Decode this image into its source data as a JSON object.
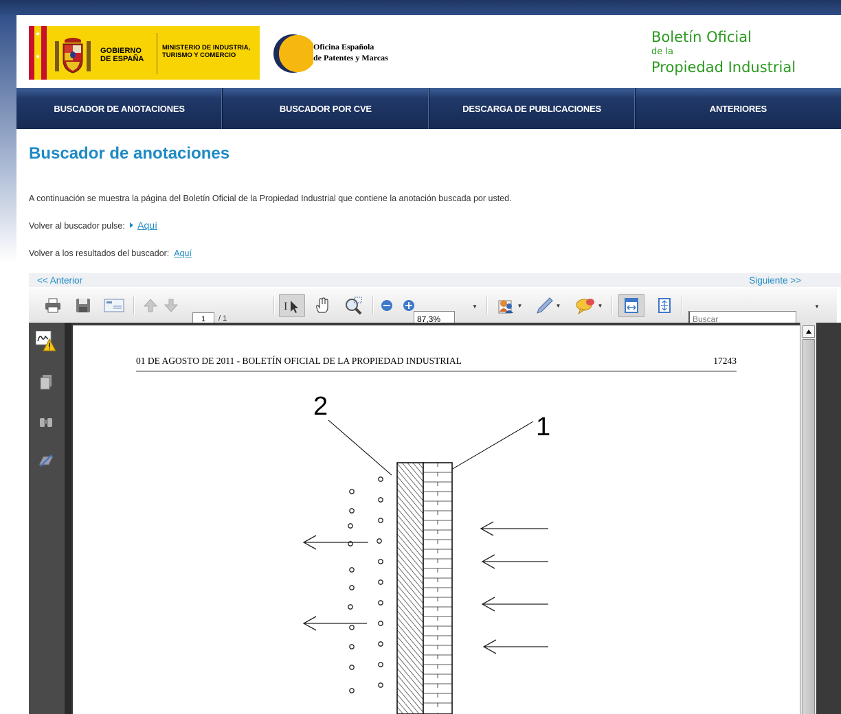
{
  "header": {
    "gov_name": "GOBIERNO DE ESPAÑA",
    "ministry": "MINISTERIO DE INDUSTRIA, TURISMO Y COMERCIO",
    "oepm_line1": "Oficina Española",
    "oepm_line2": "de Patentes y Marcas",
    "bopi_line1": "Boletín Oficial",
    "bopi_line2": "de la",
    "bopi_line3": "Propiedad Industrial",
    "colors": {
      "gov_yellow": "#f9d405",
      "bopi_green": "#2c9a1f",
      "oepm_orange": "#f6b70f",
      "oepm_navy": "#1d2b5c"
    }
  },
  "nav": {
    "items": [
      {
        "label": "BUSCADOR DE ANOTACIONES"
      },
      {
        "label": "BUSCADOR POR CVE"
      },
      {
        "label": "DESCARGA DE PUBLICACIONES"
      },
      {
        "label": "ANTERIORES"
      }
    ]
  },
  "main": {
    "title": "Buscador de anotaciones",
    "intro": "A continuación se muestra la página del Boletín Oficial de la Propiedad Industrial que contiene la anotación buscada por usted.",
    "back_search_label": "Volver al buscador pulse:",
    "back_search_link": "Aquí",
    "back_results_label": "Volver a los resultados del buscador:",
    "back_results_link": "Aquí"
  },
  "pager": {
    "prev": "<< Anterior",
    "next": "Siguiente >>"
  },
  "toolbar": {
    "page_current": "1",
    "page_total": "/ 1",
    "zoom": "87,3%",
    "search_placeholder": "Buscar",
    "icons": [
      "print-icon",
      "save-icon",
      "email-icon",
      "previous-page-icon",
      "next-page-icon",
      "select-text-icon",
      "hand-tool-icon",
      "marquee-zoom-icon",
      "zoom-out-icon",
      "zoom-in-icon",
      "sign-icon",
      "highlight-pen-icon",
      "comment-icon",
      "fit-width-icon",
      "fit-page-icon"
    ]
  },
  "sidebar": {
    "icons": [
      "signatures-warning-icon",
      "pages-icon",
      "binoculars-icon",
      "layers-icon"
    ]
  },
  "document": {
    "header_text": "01 DE AGOSTO DE 2011 - BOLETÍN OFICIAL DE LA PROPIEDAD INDUSTRIAL",
    "page_number": "17243",
    "figure_label_1": "1",
    "figure_label_2": "2"
  }
}
